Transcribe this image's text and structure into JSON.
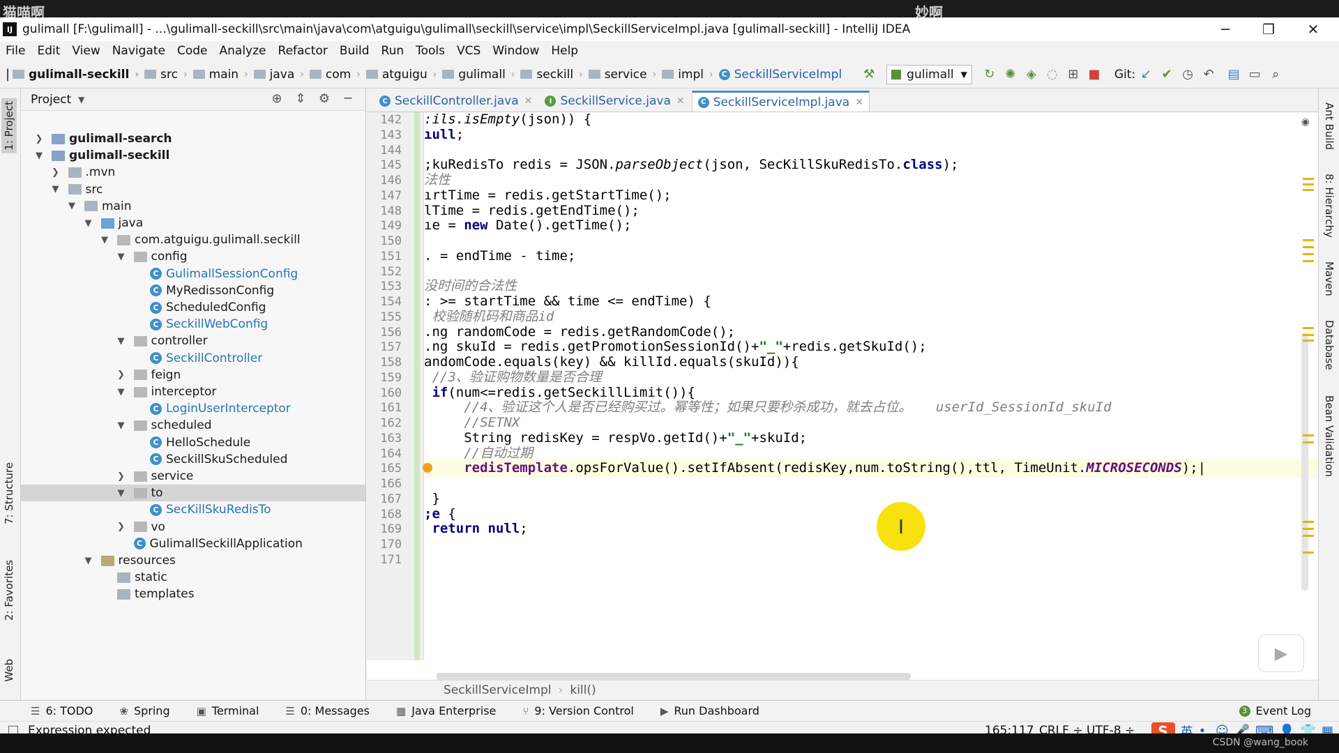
{
  "watermark": {
    "left": "猫喵啊",
    "right": "妙啊"
  },
  "credit": "CSDN @wang_book",
  "window": {
    "app_icon": "IJ",
    "title": "gulimall [F:\\gulimall] - ...\\gulimall-seckill\\src\\main\\java\\com\\atguigu\\gulimall\\seckill\\service\\impl\\SeckillServiceImpl.java [gulimall-seckill] - IntelliJ IDEA",
    "controls": {
      "minimize": "─",
      "restore": "❐",
      "close": "✕"
    }
  },
  "menu": [
    "File",
    "Edit",
    "View",
    "Navigate",
    "Code",
    "Analyze",
    "Refactor",
    "Build",
    "Run",
    "Tools",
    "VCS",
    "Window",
    "Help"
  ],
  "breadcrumbs": [
    "gulimall-seckill",
    "src",
    "main",
    "java",
    "com",
    "atguigu",
    "gulimall",
    "seckill",
    "service",
    "impl",
    "SeckillServiceImpl"
  ],
  "toolbar": {
    "run_config": "gulimall",
    "git_label": "Git:"
  },
  "left_tabs": [
    "1: Project",
    "7: Structure",
    "2: Favorites",
    "Web"
  ],
  "right_tabs": [
    "Ant Build",
    "8: Hierarchy",
    "Maven",
    "Database",
    "Bean Validation"
  ],
  "project_panel": {
    "title": "Project",
    "tree": [
      {
        "label": "gulimall-search",
        "depth": 0,
        "arrow": "right",
        "icon": "module",
        "style": "bold"
      },
      {
        "label": "gulimall-seckill",
        "depth": 0,
        "arrow": "down",
        "icon": "module",
        "style": "bold"
      },
      {
        "label": ".mvn",
        "depth": 1,
        "arrow": "right",
        "icon": "folder",
        "style": ""
      },
      {
        "label": "src",
        "depth": 1,
        "arrow": "down",
        "icon": "folder",
        "style": ""
      },
      {
        "label": "main",
        "depth": 2,
        "arrow": "down",
        "icon": "folder",
        "style": ""
      },
      {
        "label": "java",
        "depth": 3,
        "arrow": "down",
        "icon": "source",
        "style": ""
      },
      {
        "label": "com.atguigu.gulimall.seckill",
        "depth": 4,
        "arrow": "down",
        "icon": "package",
        "style": ""
      },
      {
        "label": "config",
        "depth": 5,
        "arrow": "down",
        "icon": "package",
        "style": ""
      },
      {
        "label": "GulimallSessionConfig",
        "depth": 6,
        "arrow": "",
        "icon": "class",
        "style": "cyan"
      },
      {
        "label": "MyRedissonConfig",
        "depth": 6,
        "arrow": "",
        "icon": "class",
        "style": ""
      },
      {
        "label": "ScheduledConfig",
        "depth": 6,
        "arrow": "",
        "icon": "class",
        "style": ""
      },
      {
        "label": "SeckillWebConfig",
        "depth": 6,
        "arrow": "",
        "icon": "class",
        "style": "cyan"
      },
      {
        "label": "controller",
        "depth": 5,
        "arrow": "down",
        "icon": "package",
        "style": ""
      },
      {
        "label": "SeckillController",
        "depth": 6,
        "arrow": "",
        "icon": "class",
        "style": "cyan"
      },
      {
        "label": "feign",
        "depth": 5,
        "arrow": "right",
        "icon": "package",
        "style": ""
      },
      {
        "label": "interceptor",
        "depth": 5,
        "arrow": "down",
        "icon": "package",
        "style": ""
      },
      {
        "label": "LoginUserInterceptor",
        "depth": 6,
        "arrow": "",
        "icon": "class",
        "style": "cyan"
      },
      {
        "label": "scheduled",
        "depth": 5,
        "arrow": "down",
        "icon": "package",
        "style": ""
      },
      {
        "label": "HelloSchedule",
        "depth": 6,
        "arrow": "",
        "icon": "class",
        "style": ""
      },
      {
        "label": "SeckillSkuScheduled",
        "depth": 6,
        "arrow": "",
        "icon": "class",
        "style": ""
      },
      {
        "label": "service",
        "depth": 5,
        "arrow": "right",
        "icon": "package",
        "style": ""
      },
      {
        "label": "to",
        "depth": 5,
        "arrow": "down",
        "icon": "package",
        "style": "",
        "selected": true
      },
      {
        "label": "SecKillSkuRedisTo",
        "depth": 6,
        "arrow": "",
        "icon": "class",
        "style": "cyan"
      },
      {
        "label": "vo",
        "depth": 5,
        "arrow": "right",
        "icon": "package",
        "style": ""
      },
      {
        "label": "GulimallSeckillApplication",
        "depth": 5,
        "arrow": "",
        "icon": "class",
        "style": ""
      },
      {
        "label": "resources",
        "depth": 3,
        "arrow": "down",
        "icon": "resources",
        "style": ""
      },
      {
        "label": "static",
        "depth": 4,
        "arrow": "",
        "icon": "folder",
        "style": ""
      },
      {
        "label": "templates",
        "depth": 4,
        "arrow": "",
        "icon": "folder",
        "style": ""
      }
    ]
  },
  "editor": {
    "tabs": [
      {
        "label": "SeckillController.java",
        "icon": "C",
        "active": false
      },
      {
        "label": "SeckillService.java",
        "icon": "I",
        "active": false
      },
      {
        "label": "SeckillServiceImpl.java",
        "icon": "C",
        "active": true
      }
    ],
    "current_line": "165",
    "lines": [
      {
        "n": "142",
        "html": "<span class=\"it\">:ils.isEmpty</span>(json)) {"
      },
      {
        "n": "143",
        "html": "<span class=\"kw\">ıull</span>;"
      },
      {
        "n": "144",
        "html": ""
      },
      {
        "n": "145",
        "html": ";kuRedisTo redis = JSON.<span class=\"it\">parseObject</span>(json, SecKillSkuRedisTo.<span class=\"kw\">class</span>);"
      },
      {
        "n": "146",
        "html": "<span class=\"cm cjk\">法性</span>"
      },
      {
        "n": "147",
        "html": "ırtTime = redis.getStartTime();"
      },
      {
        "n": "148",
        "html": "lTime = redis.getEndTime();"
      },
      {
        "n": "149",
        "html": "ıe = <span class=\"kw\">new</span> Date().getTime();"
      },
      {
        "n": "150",
        "html": ""
      },
      {
        "n": "151",
        "html": ". = endTime - time;"
      },
      {
        "n": "152",
        "html": ""
      },
      {
        "n": "153",
        "html": "<span class=\"cm cjk\">没时间的合法性</span>"
      },
      {
        "n": "154",
        "html": ": &gt;= startTime &amp;&amp; time &lt;= endTime) {"
      },
      {
        "n": "155",
        "html": " <span class=\"cm\"><span class=\"cjk\">校验随机码和商品</span>id</span>"
      },
      {
        "n": "156",
        "html": ".ng randomCode = redis.getRandomCode();"
      },
      {
        "n": "157",
        "html": ".ng skuId = redis.getPromotionSessionId()+<span class=\"str\">\"_\"</span>+redis.getSkuId();"
      },
      {
        "n": "158",
        "html": "andomCode.equals(key) &amp;&amp; killId.equals(skuId)){"
      },
      {
        "n": "159",
        "html": " <span class=\"cm\">//3<span class=\"cjk\">、验证购物数量是否合理</span></span>"
      },
      {
        "n": "160",
        "html": " <span class=\"kw\">if</span>(num&lt;=redis.getSeckillLimit()){"
      },
      {
        "n": "161",
        "html": "     <span class=\"cm\">//4<span class=\"cjk\">、验证这个人是否已经购买过。幂等性；如果只要秒杀成功，就去占位。</span>   userId_SessionId_skuId</span>"
      },
      {
        "n": "162",
        "html": "     <span class=\"cm\">//SETNX</span>"
      },
      {
        "n": "163",
        "html": "     String redisKey = respVo.getId()+<span class=\"str\">\"_\"</span>+skuId;"
      },
      {
        "n": "164",
        "html": "     <span class=\"cm\">//<span class=\"cjk\">自动过期</span></span>"
      },
      {
        "n": "165",
        "html": "     <span class=\"fld\" style=\"font-style:normal\">redisTemplate</span>.opsForValue().setIfAbsent(redisKey,num.toString(),ttl, TimeUnit.<span class=\"fld\">MICROSECONDS</span>);|"
      },
      {
        "n": "166",
        "html": ""
      },
      {
        "n": "167",
        "html": " }"
      },
      {
        "n": "168",
        "html": "<span class=\"kw\">;e</span> {"
      },
      {
        "n": "169",
        "html": " <span class=\"kw\">return null</span>;"
      },
      {
        "n": "170",
        "html": ""
      },
      {
        "n": "171",
        "html": ""
      }
    ],
    "breadcrumb": [
      "SeckillServiceImpl",
      "kill()"
    ]
  },
  "bottom_tools": [
    {
      "label": "6: TODO",
      "icon": "☰"
    },
    {
      "label": "Spring",
      "icon": "❀"
    },
    {
      "label": "Terminal",
      "icon": "▣"
    },
    {
      "label": "0: Messages",
      "icon": "☰"
    },
    {
      "label": "Java Enterprise",
      "icon": "▦"
    },
    {
      "label": "9: Version Control",
      "icon": "⑂"
    },
    {
      "label": "Run Dashboard",
      "icon": "▶"
    }
  ],
  "event_log": {
    "label": "Event Log",
    "badge": "3"
  },
  "status": {
    "message": "Expression expected",
    "position": "165:117",
    "line_sep": "CRLF ÷",
    "encoding": "UTF-8 ÷",
    "ime": "英"
  },
  "colors": {
    "accent": "#4a88c7",
    "keyword": "#000080",
    "comment": "#808080",
    "cursor_highlight": "#f7e10e"
  }
}
